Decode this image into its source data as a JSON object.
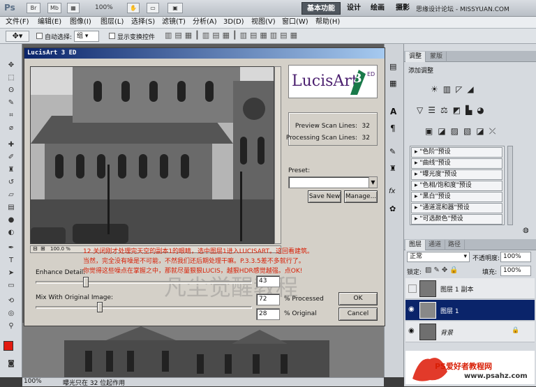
{
  "appbar": {
    "logo": "Ps",
    "bridge": "Br",
    "minibridge": "Mb",
    "zoom": "100%",
    "workspaces": [
      "基本功能",
      "设计",
      "绘画",
      "摄影"
    ],
    "site": "思缘设计论坛 - MISSYUAN.COM"
  },
  "menus": [
    "文件(F)",
    "编辑(E)",
    "图像(I)",
    "图层(L)",
    "选择(S)",
    "滤镜(T)",
    "分析(A)",
    "3D(D)",
    "视图(V)",
    "窗口(W)",
    "帮助(H)"
  ],
  "options": {
    "auto_select_label": "自动选择:",
    "auto_select_value": "组",
    "show_transform_label": "显示变换控件"
  },
  "dialog": {
    "title": "LucisArt 3 ED",
    "logo_text": "LucisArt",
    "logo_num": "3",
    "logo_ed": "ED",
    "preview_scan_label": "Preview Scan Lines:",
    "preview_scan_value": "32",
    "processing_scan_label": "Processing Scan Lines:",
    "processing_scan_value": "32",
    "preset_label": "Preset:",
    "save_new": "Save New",
    "manage": "Manage...",
    "zoom_label": "100.0 %",
    "enhance_label": "Enhance Detail:",
    "enhance_value": "43",
    "enhance_fraction": 0.43,
    "mix_label": "Mix With Original Image:",
    "mix_value": "72",
    "mix_fraction": 0.28,
    "processed_label": "% Processed",
    "original_value": "28",
    "original_label": "% Original",
    "ok": "OK",
    "cancel": "Cancel",
    "note_line1": "12.关闭刚才处理完天空的副本1的眼睛，选中图层1进入LUCISART。这回看建筑。",
    "note_line2": "当然，完全没有噪是不可能，不然我们还后期处理干嘛。P.3.3.5差不多就行了。",
    "note_line3": "你觉得这些噪点在掌握之中，那就尽量狠狠LUCIS，越狠HDR感觉越强。点OK!",
    "watermark": "凡尘觉醒教程"
  },
  "status": {
    "zoom": "100%",
    "text": "曝光只在 32 位起作用"
  },
  "adjust_panel": {
    "tabs": [
      "调整",
      "蒙版"
    ],
    "title": "添加调整",
    "presets": [
      "\"色阶\"预设",
      "\"曲线\"预设",
      "\"曝光度\"预设",
      "\"色相/饱和度\"预设",
      "\"黑白\"预设",
      "\"通道混和器\"预设",
      "\"可选颜色\"预设"
    ]
  },
  "layers_panel": {
    "tabs": [
      "图层",
      "通道",
      "路径"
    ],
    "blend_mode": "正常",
    "opacity_label": "不透明度:",
    "opacity": "100%",
    "lock_label": "锁定:",
    "fill_label": "填充:",
    "fill": "100%",
    "layers": [
      {
        "name": "图层 1 副本",
        "visible": false,
        "selected": false
      },
      {
        "name": "图层 1",
        "visible": true,
        "selected": true
      },
      {
        "name": "背景",
        "visible": true,
        "selected": false
      }
    ]
  },
  "footer_watermark": "PS爱好者教程网",
  "footer_url": "www.psahz.com",
  "colors": {
    "foreground": "#e21a10",
    "background": "#ffffff",
    "note": "#d81e05",
    "selected": "#0a246a"
  }
}
